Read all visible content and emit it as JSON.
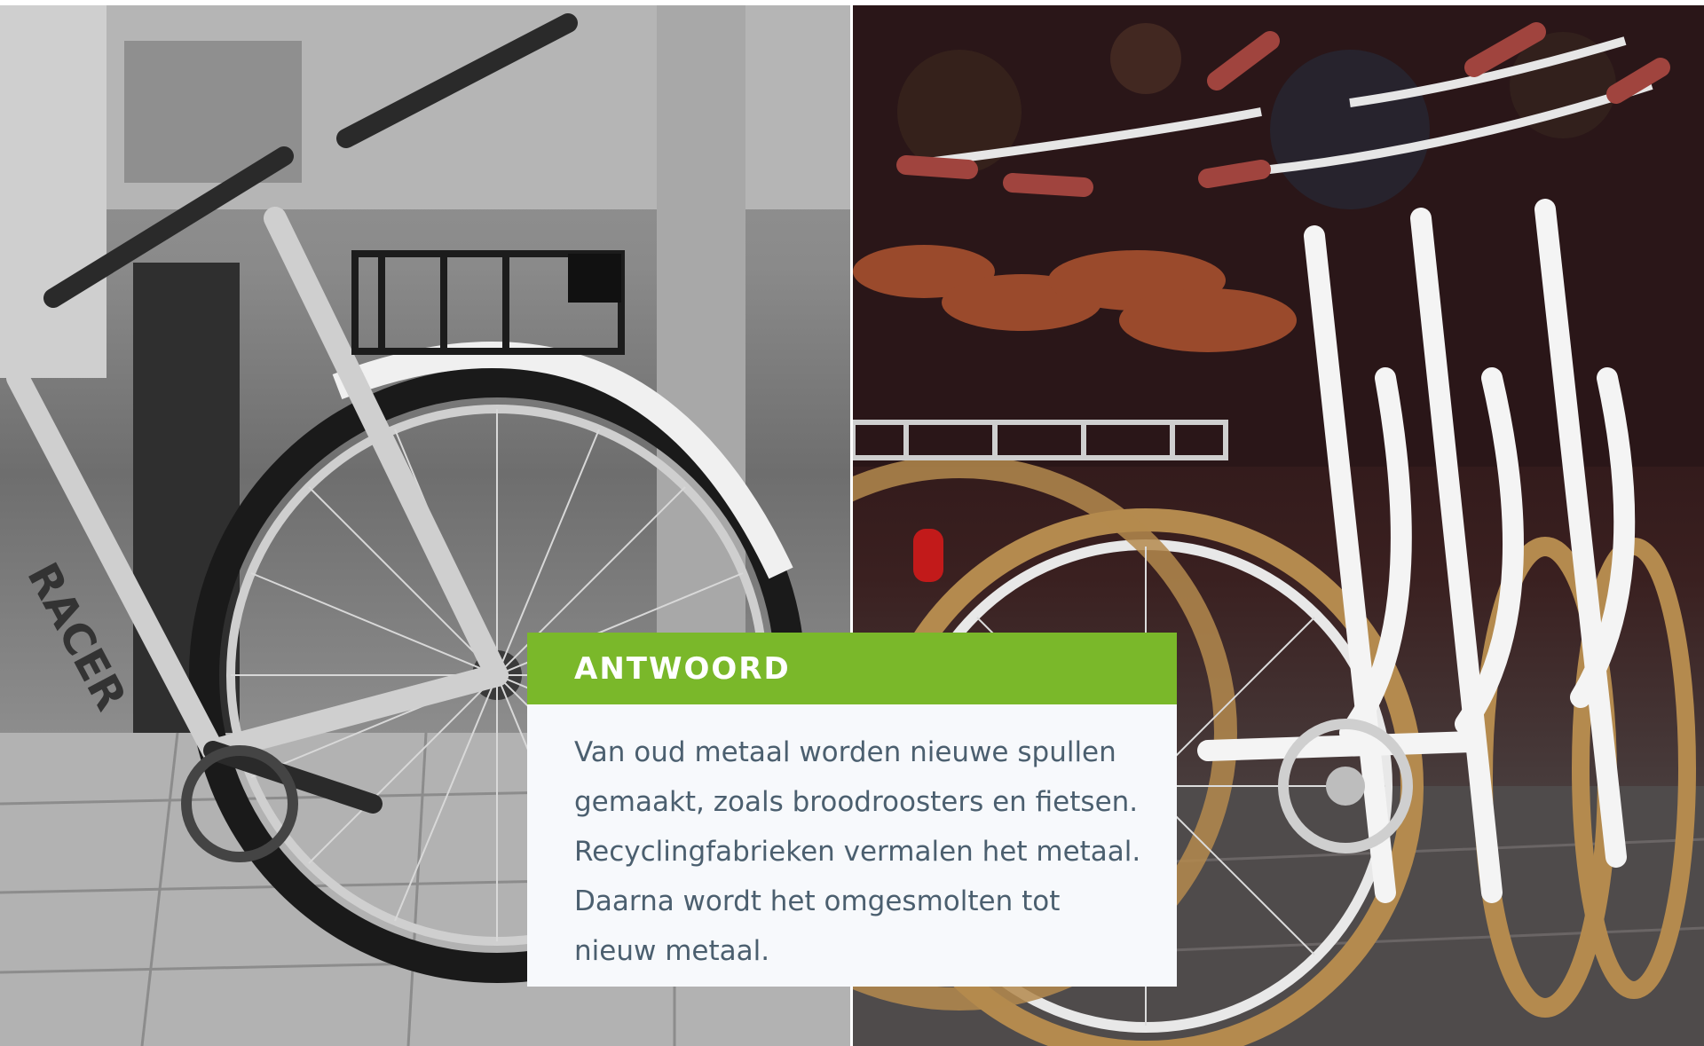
{
  "left_photo": {
    "subject": "bike-photo-grayscale",
    "frame_text": "RACER"
  },
  "right_photo": {
    "subject": "bike-photo-color"
  },
  "answer": {
    "title": "ANTWOORD",
    "body": "Van oud metaal worden nieuwe spullen gemaakt, zoals broodroosters en fietsen. Recyclingfabrieken vermalen het metaal. Daarna wordt het omgesmolten tot nieuw metaal.",
    "header_color": "#7ab82a",
    "text_color": "#4b5f6f",
    "card_color": "#f7f9fc"
  }
}
